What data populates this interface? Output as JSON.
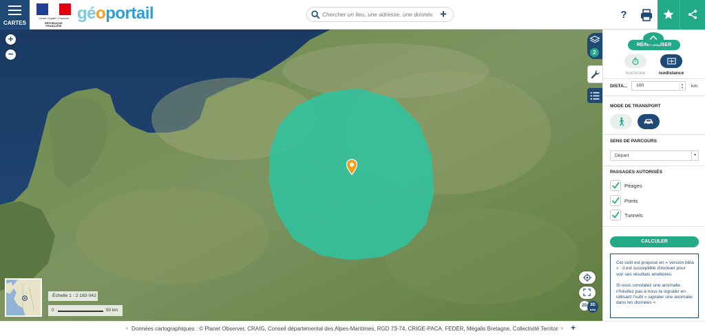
{
  "header": {
    "menu_label": "CARTES",
    "gov_motto": "Liberté • Égalité • Fraternité",
    "gov_name": "RÉPUBLIQUE FRANÇAISE",
    "logo": {
      "part1": "gé",
      "part2": "o",
      "part3": "portail"
    },
    "search": {
      "placeholder": "Chercher un lieu, une adresse, une donnée"
    },
    "help_label": "?",
    "icons": [
      "menu-icon",
      "search-icon",
      "plus-icon",
      "help-icon",
      "print-icon",
      "star-icon",
      "share-icon"
    ]
  },
  "map": {
    "zoom_in": "+",
    "zoom_out": "−",
    "layers_badge": "2",
    "scale_label": "Échelle 1 : 2 183 042",
    "scale_zero": "0",
    "scale_km": "50 km",
    "view_2d": "2D",
    "view_3d": "3D",
    "view_3d_sub": "bêta"
  },
  "panel": {
    "reset_label": "RÉINITIALISER",
    "modes": [
      {
        "label": "isochrone",
        "active": false
      },
      {
        "label": "isodistance",
        "active": true
      }
    ],
    "distance": {
      "label": "DISTA...",
      "value": "100",
      "unit": "km"
    },
    "transport": {
      "title": "MODE DE TRANSPORT",
      "selected": "car"
    },
    "direction": {
      "title": "SENS DE PARCOURS",
      "value": "Départ"
    },
    "passages": {
      "title": "PASSAGES AUTORISÉS",
      "items": [
        {
          "label": "Péages",
          "checked": true
        },
        {
          "label": "Ponts",
          "checked": true
        },
        {
          "label": "Tunnels",
          "checked": true
        }
      ]
    },
    "calculate_label": "CALCULER",
    "beta_note": [
      "Cet outil est proposé en « version bêta » : il est susceptible d'évoluer pour voir ses résultats améliorés.",
      "Si vous constatez une anomalie n'hésitez pas à nous la signaler en utilisant l'outil « signaler une anomalie dans les données »."
    ]
  },
  "footer": {
    "prev": "‹",
    "attribution": "Données cartographiques : ©    Planet Observer,  CRAIG,  Conseil départemental des Alpes-Maritimes,  RGD 73-74,  CRIGE-PACA,  FEDER,  Mégalis Bretagne,  Collectivité Territoriale",
    "next": "›",
    "add": "+"
  },
  "colors": {
    "navy": "#1f4a75",
    "teal": "#21a988",
    "isodistance_fill": "#2ec4a0",
    "marker": "#f59f1b",
    "sea": "#1d3c62"
  }
}
